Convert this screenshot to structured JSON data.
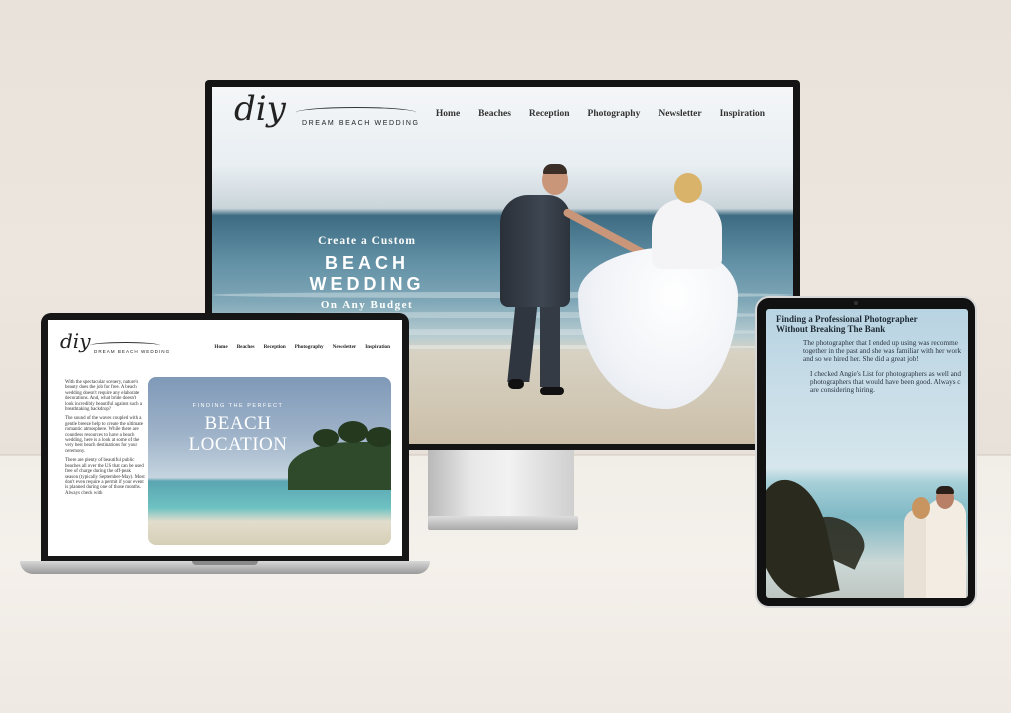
{
  "site": {
    "logo_script": "diy",
    "logo_sub": "DREAM BEACH WEDDING",
    "nav": [
      "Home",
      "Beaches",
      "Reception",
      "Photography",
      "Newsletter",
      "Inspiration"
    ]
  },
  "monitor": {
    "hero_small": "Create a Custom",
    "hero_big_1": "BEACH",
    "hero_big_2": "WEDDING",
    "hero_tag": "On Any Budget"
  },
  "laptop": {
    "para1": "With the spectacular scenery, nature's beauty does the job for free. A beach wedding doesn't require any elaborate decorations. And, what bride doesn't look incredibly beautiful against such a breathtaking backdrop?",
    "para2": "The sound of the waves coupled with a gentle breeze help to create the ultimate romantic atmosphere. While there are countless resources to have a beach wedding, here is a look at some of the very best beach destinations for your ceremony.",
    "para3": "There are plenty of beautiful public beaches all over the US that can be used free of charge during the off-peak season (typically September-May). Most don't even require a permit if your event is planned during one of those months. Always check with",
    "img_small": "FINDING THE PERFECT",
    "img_big_1": "BEACH",
    "img_big_2": "LOCATION"
  },
  "tablet": {
    "title_1": "Finding a Professional Photographer",
    "title_2": "Without Breaking The Bank",
    "body_1a": "The photographer that I ended up using was recomme",
    "body_1b": "together in the past and she was familiar with her work",
    "body_1c": "and so we hired her. She did a great job!",
    "body_2a": "I checked Angie's List for photographers as well and",
    "body_2b": "photographers that would have been good. Always c",
    "body_2c": "are considering hiring."
  },
  "colors": {
    "wall": "#ece6df",
    "floor": "#f3efea",
    "device_bezel": "#141414"
  }
}
